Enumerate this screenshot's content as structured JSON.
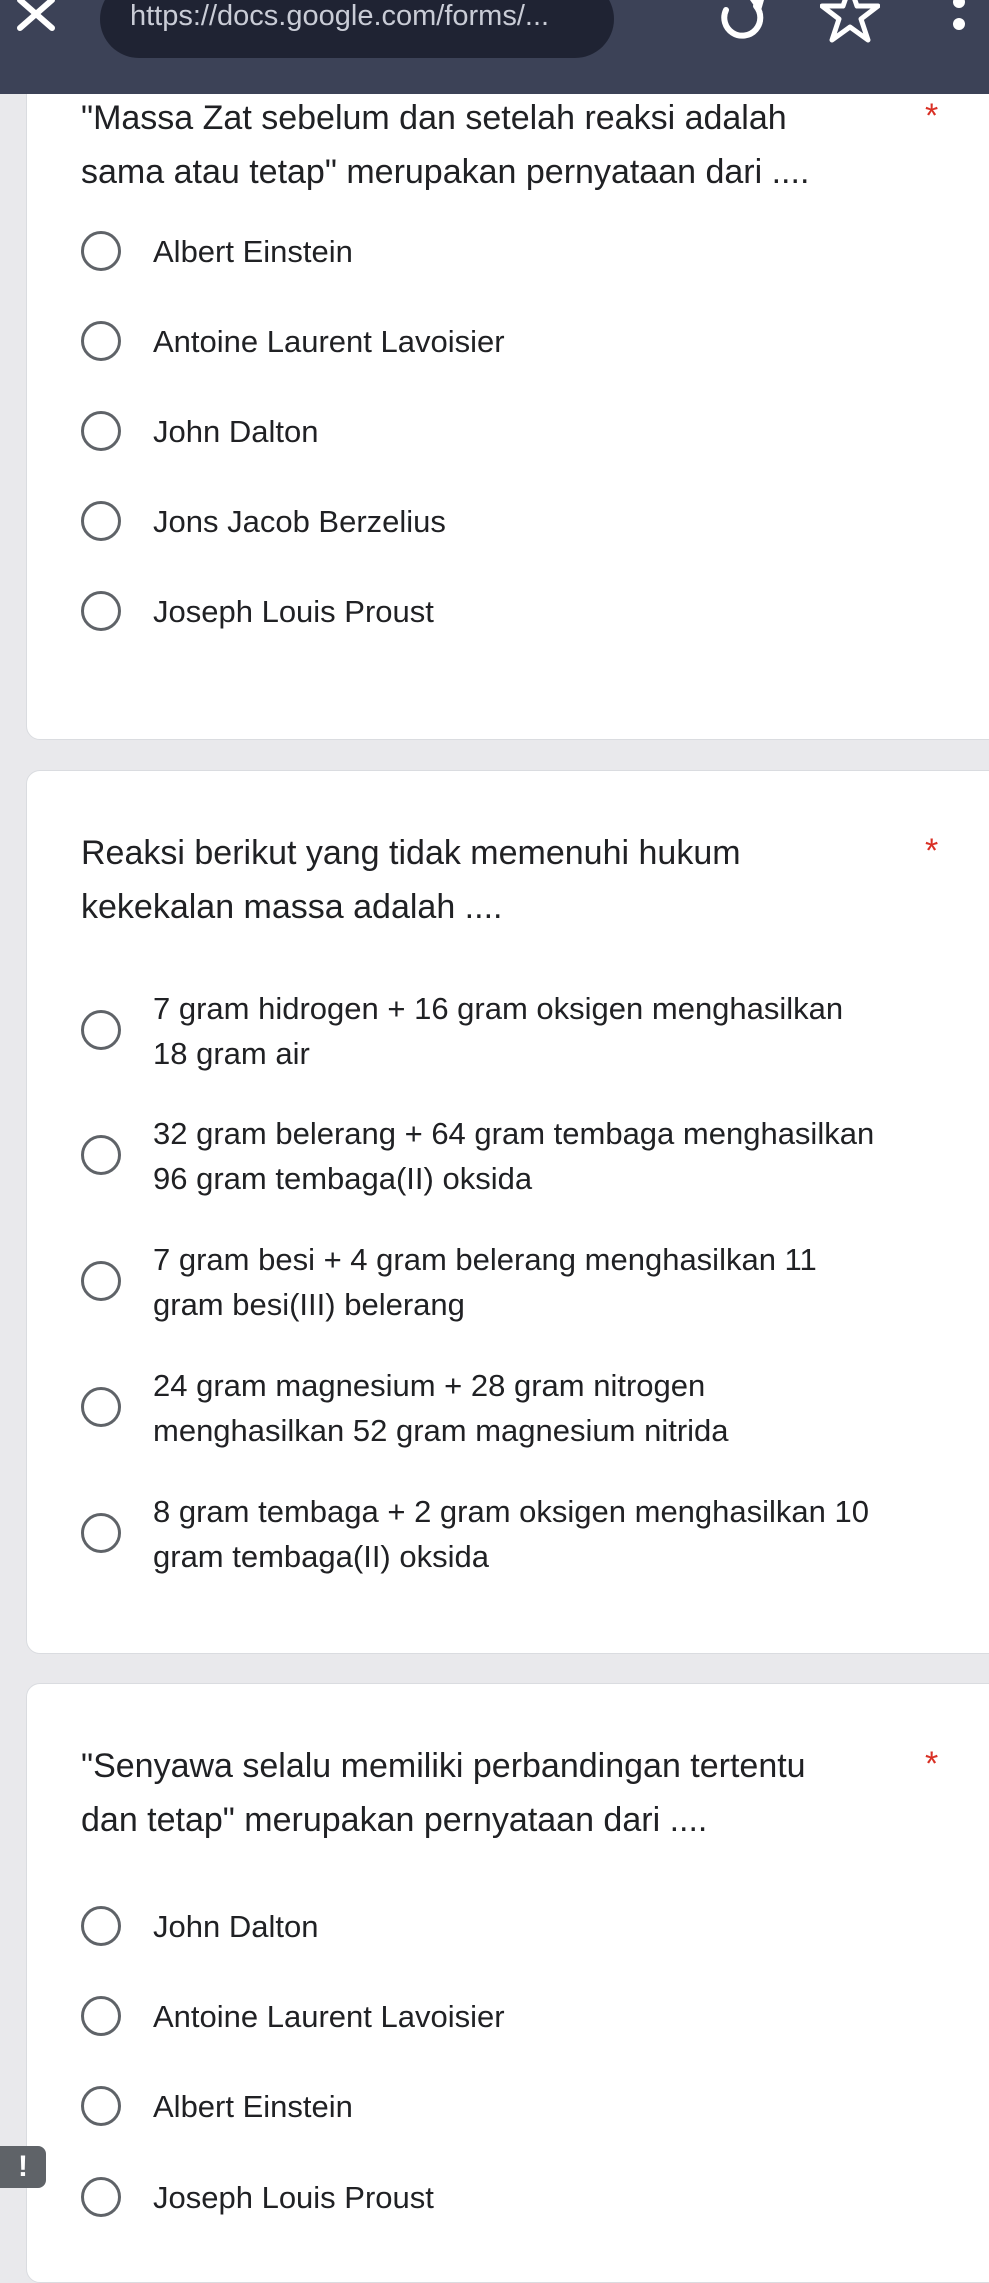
{
  "browser": {
    "url": "https://docs.google.com/forms/...",
    "close_icon": "close-icon",
    "reload_icon": "reload-icon",
    "bookmark_icon": "star-icon",
    "menu_icon": "more-vert-icon"
  },
  "colors": {
    "topbar": "#3c4257",
    "required_asterisk": "#d93025",
    "page_background": "#e9e9ec"
  },
  "questions": [
    {
      "title_line1": "\"Massa Zat sebelum dan setelah reaksi adalah",
      "title_line2": "sama atau tetap\" merupakan pernyataan dari ....",
      "required": "*",
      "options": [
        "Albert Einstein",
        "Antoine Laurent Lavoisier",
        "John Dalton",
        "Jons Jacob Berzelius",
        "Joseph Louis Proust"
      ]
    },
    {
      "title_line1": "Reaksi berikut yang tidak memenuhi hukum",
      "title_line2": "kekekalan massa adalah ....",
      "required": "*",
      "options": [
        {
          "line1": "7 gram hidrogen + 16 gram oksigen menghasilkan",
          "line2": "18 gram air"
        },
        {
          "line1": "32 gram belerang + 64 gram tembaga menghasilkan",
          "line2": "96 gram tembaga(II) oksida"
        },
        {
          "line1": "7 gram besi + 4 gram belerang menghasilkan 11",
          "line2": "gram besi(III) belerang"
        },
        {
          "line1": "24 gram magnesium + 28 gram nitrogen",
          "line2": "menghasilkan 52 gram magnesium nitrida"
        },
        {
          "line1": "8 gram tembaga + 2 gram oksigen menghasilkan 10",
          "line2": "gram tembaga(II) oksida"
        }
      ]
    },
    {
      "title_line1": "\"Senyawa selalu memiliki perbandingan tertentu",
      "title_line2": "dan tetap\" merupakan pernyataan dari ....",
      "required": "*",
      "options": [
        "John Dalton",
        "Antoine Laurent Lavoisier",
        "Albert Einstein",
        "Joseph Louis Proust"
      ]
    }
  ],
  "feedback": {
    "label": "!",
    "icon": "feedback-icon"
  }
}
